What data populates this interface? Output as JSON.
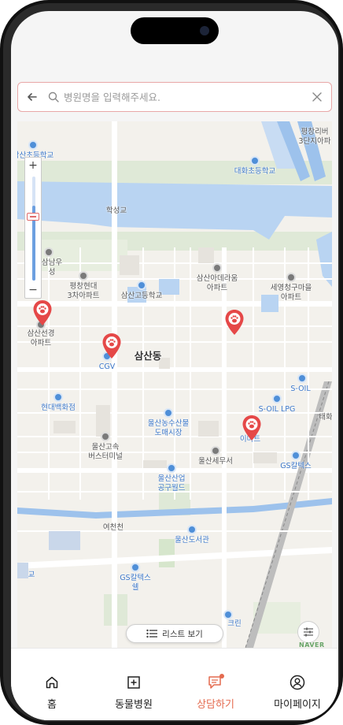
{
  "search": {
    "placeholder": "병원명을 입력해주세요."
  },
  "map": {
    "labels": [
      {
        "id": "place-top-left",
        "text": "삼산초등학교",
        "style": "blue"
      },
      {
        "id": "place-daehwa-school",
        "text": "대화초등학교",
        "style": "blue"
      },
      {
        "id": "place-top-right",
        "text": "평창리버\n3단지아파",
        "style": "plain"
      },
      {
        "id": "place-hakseong-bridge",
        "text": "학성교",
        "style": "plain"
      },
      {
        "id": "place-left-apt",
        "text": "삼남우\n성",
        "style": "plain"
      },
      {
        "id": "place-pyeongchang",
        "text": "평창현대\n3차아파트",
        "style": "plain"
      },
      {
        "id": "place-samsan-high",
        "text": "삼산고등학교",
        "style": "plain"
      },
      {
        "id": "place-samsan-adeure",
        "text": "삼산아데라움\n아파트",
        "style": "plain"
      },
      {
        "id": "place-sehyeong",
        "text": "세영청구마을\n아파트",
        "style": "plain"
      },
      {
        "id": "place-samsan-seongwon",
        "text": "삼산선경\n아파트",
        "style": "plain"
      },
      {
        "id": "place-cgv",
        "text": "CGV",
        "style": "blue"
      },
      {
        "id": "place-samsan-dong",
        "text": "삼산동",
        "style": "big"
      },
      {
        "id": "place-soil",
        "text": "S-OIL",
        "style": "blue"
      },
      {
        "id": "place-hyundai-dept",
        "text": "현대백화점",
        "style": "blue"
      },
      {
        "id": "place-soil-lpg",
        "text": "S-OIL LPG",
        "style": "blue"
      },
      {
        "id": "place-taehwa",
        "text": "태화",
        "style": "plain"
      },
      {
        "id": "place-ulsan-market",
        "text": "울산농수산물\n도매시장",
        "style": "blue"
      },
      {
        "id": "place-emart",
        "text": "이마트",
        "style": "blue"
      },
      {
        "id": "place-ulsan-bus",
        "text": "울산고속\n버스터미널",
        "style": "plain"
      },
      {
        "id": "place-ulsan-tax",
        "text": "울산세무서",
        "style": "plain"
      },
      {
        "id": "place-gs-caltex",
        "text": "GS칼텍스",
        "style": "blue"
      },
      {
        "id": "place-ulsan-industry",
        "text": "울산산업\n공구월드",
        "style": "blue"
      },
      {
        "id": "place-yeocheon",
        "text": "여천천",
        "style": "plain"
      },
      {
        "id": "place-ulsan-library",
        "text": "울산도서관",
        "style": "blue"
      },
      {
        "id": "place-bottom-left",
        "text": "교",
        "style": "blue"
      },
      {
        "id": "place-gs-shell",
        "text": "GS칼텍스\n쉘",
        "style": "blue"
      },
      {
        "id": "place-bottom-cre",
        "text": "크린",
        "style": "blue"
      }
    ],
    "markers": [
      {
        "id": "hospital-marker-1",
        "label": "hospital"
      },
      {
        "id": "hospital-marker-2",
        "label": "hospital"
      },
      {
        "id": "hospital-marker-3",
        "label": "hospital"
      },
      {
        "id": "hospital-marker-4",
        "label": "hospital"
      }
    ],
    "zoom": {
      "plus": "+",
      "minus": "−",
      "level": 0.72
    },
    "list_button_label": "리스트 보기",
    "provider_logo": "NAVER"
  },
  "tabbar": {
    "items": [
      {
        "label": "홈",
        "icon": "home-icon",
        "active": false
      },
      {
        "label": "동물병원",
        "icon": "plus-square-icon",
        "active": false
      },
      {
        "label": "상담하기",
        "icon": "chat-icon",
        "active": true
      },
      {
        "label": "마이페이지",
        "icon": "user-icon",
        "active": false
      }
    ]
  },
  "colors": {
    "accent": "#e46a4e",
    "marker": "#e54848",
    "river": "#b9d4f2",
    "search_border": "#e8a7a7"
  }
}
